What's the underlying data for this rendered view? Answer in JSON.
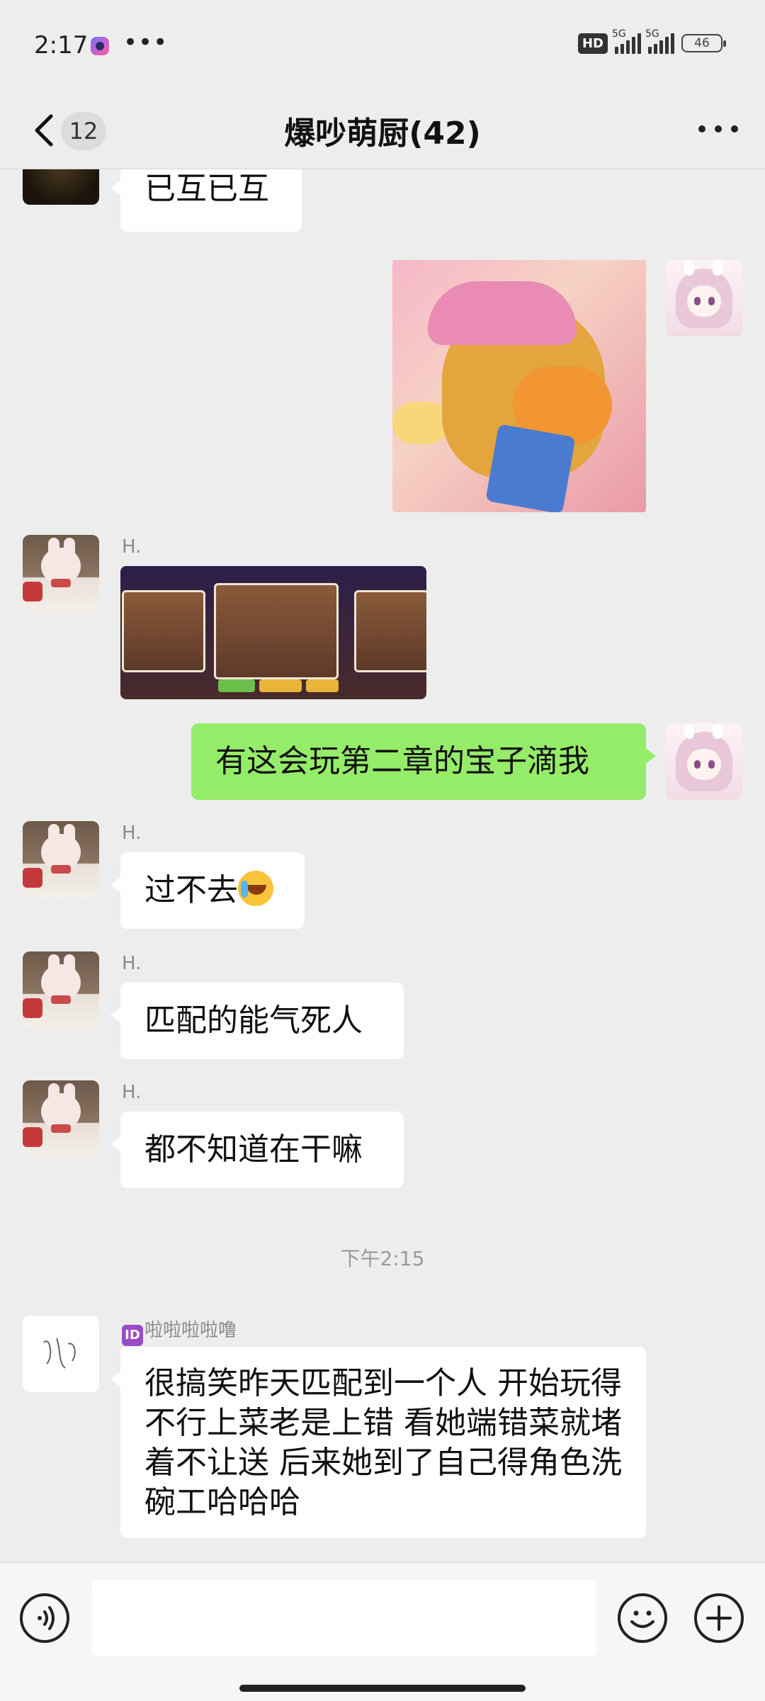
{
  "status_bar": {
    "time": "2:17",
    "dots": "•••",
    "hd": "HD",
    "net1": "5G",
    "net2": "5G",
    "battery": "46"
  },
  "header": {
    "unread_count": "12",
    "title": "爆吵萌厨(42)"
  },
  "messages": [
    {
      "id": "m1",
      "direction": "in",
      "text": "已互已互"
    },
    {
      "id": "m2",
      "direction": "out",
      "type": "image",
      "alt": "capybara-sticker"
    },
    {
      "id": "m3",
      "direction": "in",
      "sender": "H.",
      "type": "image",
      "alt": "game-screenshot"
    },
    {
      "id": "m4",
      "direction": "out",
      "text": "有这会玩第二章的宝子滴我"
    },
    {
      "id": "m5",
      "direction": "in",
      "sender": "H.",
      "text": "过不去",
      "emoji": "crying-laughing-emoji"
    },
    {
      "id": "m6",
      "direction": "in",
      "sender": "H.",
      "text": "匹配的能气死人"
    },
    {
      "id": "m7",
      "direction": "in",
      "sender": "H.",
      "text": "都不知道在干嘛"
    },
    {
      "id": "m8",
      "direction": "in",
      "sender": "啦啦啦啦噜",
      "text": "很搞笑昨天匹配到一个人 开始玩得不行上菜老是上错 看她端错菜就堵着不让送 后来她到了自己得角色洗碗工哈哈哈"
    }
  ],
  "timestamp": "下午2:15",
  "input": {
    "value": "",
    "placeholder": ""
  },
  "colors": {
    "background": "#ededed",
    "outgoing_bubble": "#95ec69",
    "incoming_bubble": "#ffffff"
  }
}
